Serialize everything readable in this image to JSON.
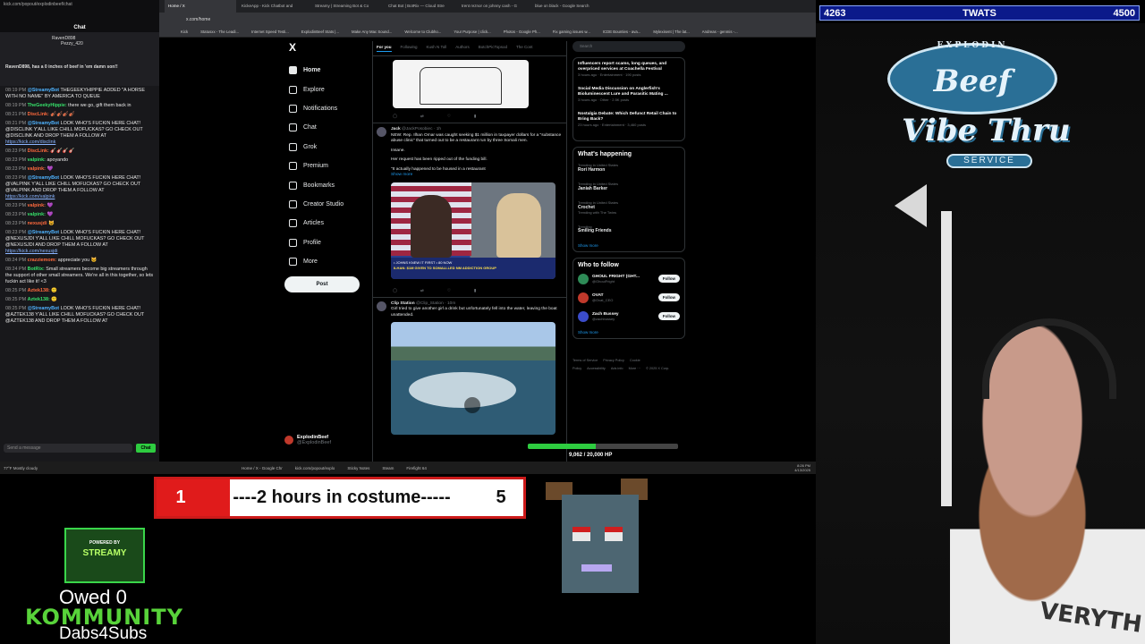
{
  "chat": {
    "header_url": "kick.com/popout/explodinbeef/chat",
    "title": "Chat",
    "pinned": [
      {
        "user": "StationS",
        "text": "RavenD898"
      },
      {
        "user": "",
        "text": "Pezzy_420"
      }
    ],
    "pinned_note": "RavenD898, has a 0 inches of beef in 'em damn son!!",
    "messages": [
      {
        "time": "08:19 PM",
        "user": "@StreamyBot",
        "text": "THEGEEKYHIPPIE ADDED \"A HORSE WITH NO NAME\" BY AMERICA TO QUEUE"
      },
      {
        "time": "08:19 PM",
        "user": "TheGeekyHippie:",
        "text": "there we go, gift them back in"
      },
      {
        "time": "08:21 PM",
        "user": "DiscLink:",
        "text": "🎻🎻🎻🎻"
      },
      {
        "time": "08:21 PM",
        "user": "@StreamyBot",
        "text": "LOOK WHO'S FUCKIN HERE CHAT! @DISCLINK Y'ALL LIKE CHILL MOFUCKAS? GO CHECK OUT @DISCLINK AND DROP THEM A FOLLOW AT",
        "link": "https://kick.com/disclink"
      },
      {
        "time": "08:23 PM",
        "user": "DiscLink:",
        "text": "🎸🎸🎸🎸"
      },
      {
        "time": "08:23 PM",
        "user": "valpink:",
        "text": "apoyando"
      },
      {
        "time": "08:23 PM",
        "user": "valpink:",
        "text": "💜"
      },
      {
        "time": "08:23 PM",
        "user": "@StreamyBot",
        "text": "LOOK WHO'S FUCKIN HERE CHAT! @VALPINK Y'ALL LIKE CHILL MOFUCKAS? GO CHECK OUT @VALPINK AND DROP THEM A FOLLOW AT",
        "link": "https://kick.com/valpink"
      },
      {
        "time": "08:23 PM",
        "user": "valpink:",
        "text": "💜"
      },
      {
        "time": "08:23 PM",
        "user": "valpink:",
        "text": "💜"
      },
      {
        "time": "08:23 PM",
        "user": "nexusjdi",
        "text": "😺"
      },
      {
        "time": "08:23 PM",
        "user": "@StreamyBot",
        "text": "LOOK WHO'S FUCKIN HERE CHAT! @NEXUSJDI Y'ALL LIKE CHILL MOFUCKAS? GO CHECK OUT @NEXUSJDI AND DROP THEM A FOLLOW AT",
        "link": "https://kick.com/nexusjdi"
      },
      {
        "time": "08:24 PM",
        "user": "crazziemom:",
        "text": "appreciate you 🐱"
      },
      {
        "time": "08:24 PM",
        "user": "BotRix:",
        "text": "Small streamers become big streamers through the support of other small streamers. We're all in this together, so lets fuckin act like it! <3"
      },
      {
        "time": "08:25 PM",
        "user": "Aztek138:",
        "text": "🙂"
      },
      {
        "time": "08:25 PM",
        "user": "Aztek138:",
        "text": "🙂"
      },
      {
        "time": "08:25 PM",
        "user": "@StreamyBot",
        "text": "LOOK WHO'S FUCKIN HERE CHAT! @AZTEK138 Y'ALL LIKE CHILL MOFUCKAS? GO CHECK OUT @AZTEK138 AND DROP THEM A FOLLOW AT"
      }
    ],
    "input_placeholder": "Send a message",
    "send_label": "Chat"
  },
  "browser": {
    "tabs": [
      "Home / X",
      "KickeApp - Kick Chatbot and",
      "Streamy | Streaming Bot & Co",
      "Chat Bot | BotRix — Cloud Stre",
      "trent reznor on johnny cash - G",
      "blue on black - Google Search"
    ],
    "url": "x.com/home",
    "bookmarks": [
      "Kick",
      "Statusxx - The Leadi...",
      "Internet Speed Testi...",
      "ExplodinBeef Stats |...",
      "Make Any Mac Sound...",
      "Welcome to Clubho...",
      "Your Purpose | click...",
      "Photos - Google Ph...",
      "Fix gaming issues w...",
      "ICDE Bounties - ava...",
      "Mylexisent | The lat...",
      "Andreas - genmis -..."
    ]
  },
  "xnav": {
    "logo": "X",
    "items": [
      {
        "icon": "home-icon",
        "label": "Home"
      },
      {
        "icon": "explore-icon",
        "label": "Explore"
      },
      {
        "icon": "bell-icon",
        "label": "Notifications"
      },
      {
        "icon": "chat-icon",
        "label": "Chat"
      },
      {
        "icon": "grok-icon",
        "label": "Grok"
      },
      {
        "icon": "premium-icon",
        "label": "Premium"
      },
      {
        "icon": "bookmark-icon",
        "label": "Bookmarks"
      },
      {
        "icon": "creator-icon",
        "label": "Creator Studio"
      },
      {
        "icon": "articles-icon",
        "label": "Articles"
      },
      {
        "icon": "profile-icon",
        "label": "Profile"
      },
      {
        "icon": "more-icon",
        "label": "More"
      }
    ],
    "post_label": "Post",
    "account_name": "ExplodinBeef",
    "account_handle": "@ExplodinBeef"
  },
  "feed": {
    "tabs": [
      "For you",
      "Following",
      "Kush N Toll",
      "Authors",
      "BotchPicTopsod",
      "The Cont"
    ],
    "tweet1": {
      "name": "Jack",
      "handle": "@JackPosobiec · 1h",
      "text": "NEW: Rep. Ilhan Omar was caught seeking $1 million in taxpayer dollars for a \"substance abuse clinic\" that turned out to be a restaurant run by three Somali men.",
      "line2": "Insane.",
      "line3": "Her request has been ripped out of the funding bill.",
      "line4": "\"It actually happened to be housed in a restaurant",
      "more": "Show more",
      "chyron": "• JOHNS KNEW IT FIRST • 80 NOW",
      "chyron2": "ILHAN: $1M GIVEN TO SOMALI-LED NM ADDICTION GROUP"
    },
    "tweet2": {
      "name": "Clip Station",
      "handle": "@Clip_Station · 10m",
      "text": "Girl tried to give another girl a drink but unfortunately fell into the water, leaving the boat unattended."
    }
  },
  "sidebar": {
    "search_placeholder": "Search",
    "news": [
      {
        "title": "Influencers report scams, long queues, and overpriced services at Coachella Festival",
        "meta": "3 hours ago · Entertainment · 190 posts"
      },
      {
        "title": "Social Media Discussion on Anglerfish's Bioluminescent Lure and Parasitic Mating ...",
        "meta": "3 hours ago · Other · 2.5K posts"
      },
      {
        "title": "Nostalgia Debate: Which Defunct Retail Chain to Bring Back?",
        "meta": "23 hours ago · Entertainment · 3,460 posts"
      }
    ],
    "happening_title": "What's happening",
    "trends": [
      {
        "context": "Trending in United States",
        "name": "Rori Harmon"
      },
      {
        "context": "Trending in United States",
        "name": "Janiah Barker"
      },
      {
        "context": "Trending in United States",
        "name": "Crochet",
        "sub": "Trending with The Twins"
      },
      {
        "context": "Trending",
        "name": "Smiling Friends"
      }
    ],
    "show_more": "Show more",
    "who_title": "Who to follow",
    "who": [
      {
        "name": "GHOUL FRIGHT (GHT...",
        "handle": "@GhoulFright",
        "color": "#2e8b57"
      },
      {
        "name": "OVAT",
        "handle": "@Ovat_CEO",
        "color": "#c0392b"
      },
      {
        "name": "Zach Bussey",
        "handle": "@zachbussey",
        "color": "#3b4cca"
      }
    ],
    "follow_label": "Follow",
    "footer": [
      "Terms of Service",
      "Privacy Policy",
      "Cookie Policy",
      "Accessibility",
      "Ads info",
      "More ···",
      "© 2025 X Corp."
    ]
  },
  "taskbar": {
    "weather": "77°F Mostly cloudy",
    "apps": [
      "Home / X - Google Chr",
      "kick.com/popout/explo",
      "Sticky Notes",
      "Steam",
      "Firefight 64"
    ],
    "time": "8:26 PM",
    "date": "4/13/2025"
  },
  "overlay": {
    "ticker_left": "4263",
    "ticker_mid": "TWATS",
    "ticker_right": "4500",
    "hp_label": "9,062 / 20,000 HP",
    "hp_fraction": 0.4531,
    "goal_left": "1",
    "goal_text": "----2 hours in costume-----",
    "goal_right": "5",
    "goal_fraction": 0.2,
    "streamy_top": "POWERED BY",
    "streamy_brand": "STREAMY",
    "owed": "Owed 0",
    "kommunity": "KOMMUNITY",
    "dabs": "Dabs4Subs",
    "logo_top": "EXPLODIN",
    "logo_beef": "Beef",
    "logo_vibe": "Vibe Thru",
    "logo_service": "SERVICE",
    "shirt_text": "VERYTH"
  }
}
